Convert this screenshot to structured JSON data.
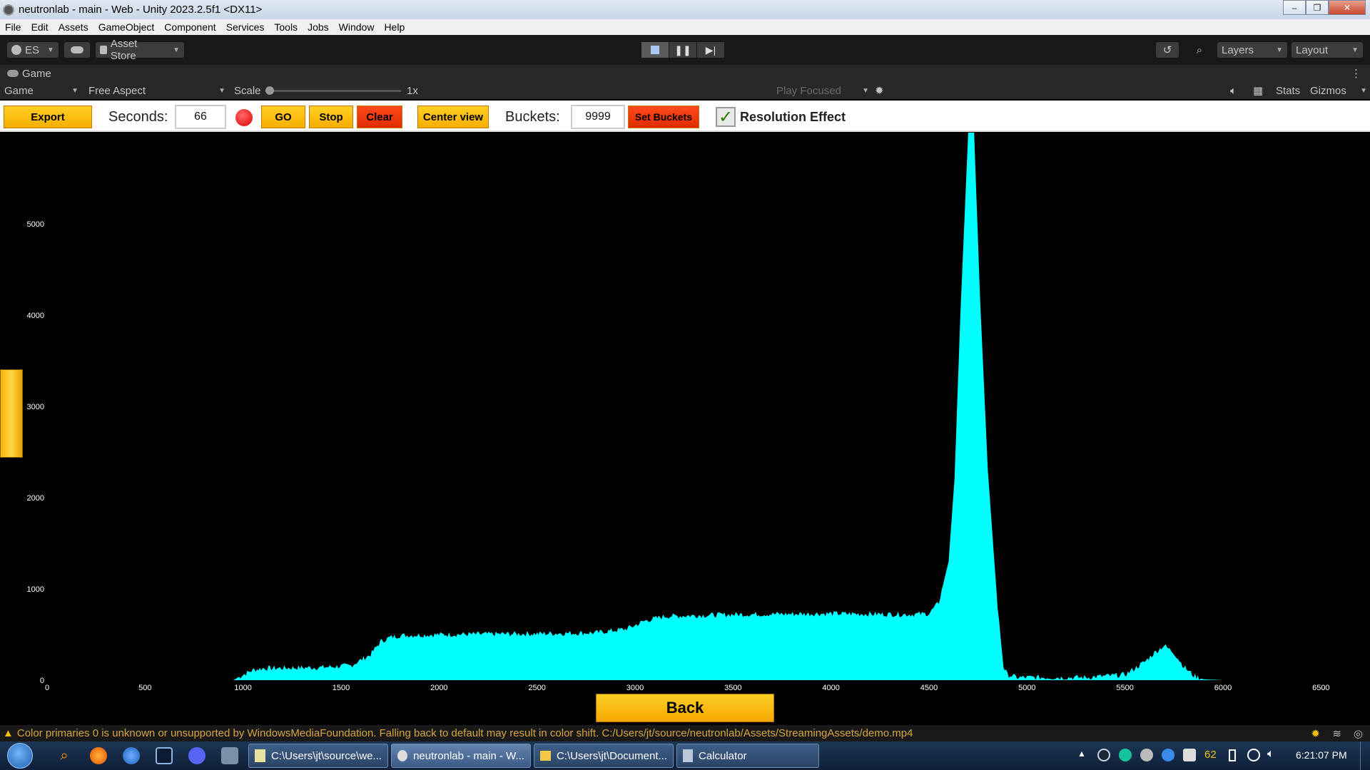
{
  "window": {
    "title": "neutronlab - main - Web - Unity 2023.2.5f1 <DX11>",
    "minimize": "–",
    "restore": "❐",
    "close": "✕"
  },
  "menu": [
    "File",
    "Edit",
    "Assets",
    "GameObject",
    "Component",
    "Services",
    "Tools",
    "Jobs",
    "Window",
    "Help"
  ],
  "toolbar": {
    "account": "ES",
    "asset_store": "Asset Store",
    "layers": "Layers",
    "layout": "Layout"
  },
  "game_tab": {
    "label": "Game",
    "display_select": "Game",
    "aspect_select": "Free Aspect",
    "scale_label": "Scale",
    "scale_value": "1x",
    "play_focused": "Play Focused",
    "stats": "Stats",
    "gizmos": "Gizmos"
  },
  "controls": {
    "export": "Export",
    "seconds_label": "Seconds:",
    "seconds_value": "66",
    "go": "GO",
    "stop": "Stop",
    "clear": "Clear",
    "center_view": "Center view",
    "buckets_label": "Buckets:",
    "buckets_value": "9999",
    "set_buckets": "Set Buckets",
    "resolution_effect": "Resolution Effect",
    "resolution_checked": true
  },
  "chart_data": {
    "type": "area",
    "color": "#00ffff",
    "background": "#000000",
    "xlim": [
      0,
      6750
    ],
    "ylim": [
      0,
      6000
    ],
    "xticks": [
      "0",
      "500",
      "1000",
      "1500",
      "2000",
      "2500",
      "3000",
      "3500",
      "4000",
      "4500",
      "5000",
      "5500",
      "6000",
      "6500"
    ],
    "yticks": [
      "0",
      "1000",
      "2000",
      "3000",
      "4000",
      "5000"
    ],
    "x": [
      0,
      950,
      1000,
      1050,
      1100,
      1400,
      1550,
      1650,
      1700,
      1750,
      1800,
      2000,
      2500,
      2800,
      2950,
      3000,
      3050,
      3150,
      3500,
      4000,
      4400,
      4500,
      4550,
      4600,
      4630,
      4660,
      4700,
      4730,
      4760,
      4800,
      4850,
      4880,
      4900,
      4950,
      5000,
      5300,
      5500,
      5600,
      5650,
      5700,
      5750,
      5800,
      5850,
      5900,
      6000,
      6750
    ],
    "y": [
      0,
      0,
      60,
      110,
      130,
      140,
      160,
      280,
      420,
      470,
      490,
      500,
      510,
      520,
      560,
      600,
      650,
      700,
      720,
      730,
      720,
      730,
      850,
      1300,
      2200,
      4000,
      6000,
      6000,
      4200,
      2300,
      800,
      150,
      60,
      30,
      30,
      30,
      60,
      200,
      300,
      380,
      300,
      150,
      50,
      10,
      0,
      0
    ]
  },
  "back_button": "Back",
  "status": {
    "message": "Color primaries 0 is unknown or unsupported by WindowsMediaFoundation. Falling back to default may result in color shift. C:/Users/jt/source/neutronlab/Assets/StreamingAssets/demo.mp4"
  },
  "taskbar": {
    "tasks": [
      "C:\\Users\\jt\\source\\we...",
      "neutronlab - main - W...",
      "C:\\Users\\jt\\Document...",
      "Calculator"
    ],
    "tray_number": "62",
    "clock": "6:21:07 PM"
  }
}
